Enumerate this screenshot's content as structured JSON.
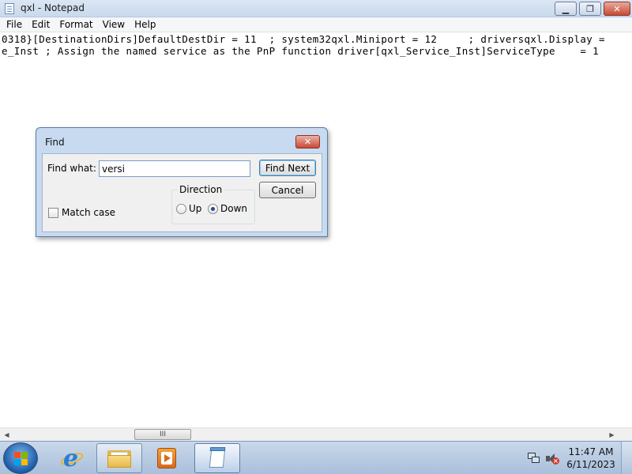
{
  "window": {
    "title": "qxl - Notepad",
    "close_glyph": "✕",
    "minimize_glyph": "▁",
    "maximize_glyph": "❐"
  },
  "menu": [
    "File",
    "Edit",
    "Format",
    "View",
    "Help"
  ],
  "editor": {
    "lines": [
      "0318}[DestinationDirs]DefaultDestDir = 11  ; system32qxl.Miniport = 12     ; driversqxl.Display = ",
      "e_Inst ; Assign the named service as the PnP function driver[qxl_Service_Inst]ServiceType    = 1"
    ]
  },
  "scrollbar": {
    "thumb_grip": "III",
    "left_arrow": "◀",
    "right_arrow": "▶"
  },
  "find_dialog": {
    "title": "Find",
    "close_glyph": "✕",
    "find_what_label": "Find what:",
    "find_what_value": "versi",
    "find_next_button": "Find Next",
    "cancel_button": "Cancel",
    "direction_label": "Direction",
    "up_label": "Up",
    "down_label": "Down",
    "selected_direction": "Down",
    "match_case_label": "Match case",
    "match_case_checked": false
  },
  "taskbar": {
    "clock_time": "11:47 AM",
    "clock_date": "6/11/2023",
    "items": [
      "Internet Explorer",
      "Windows Explorer",
      "Windows Media Player",
      "Notepad"
    ]
  }
}
